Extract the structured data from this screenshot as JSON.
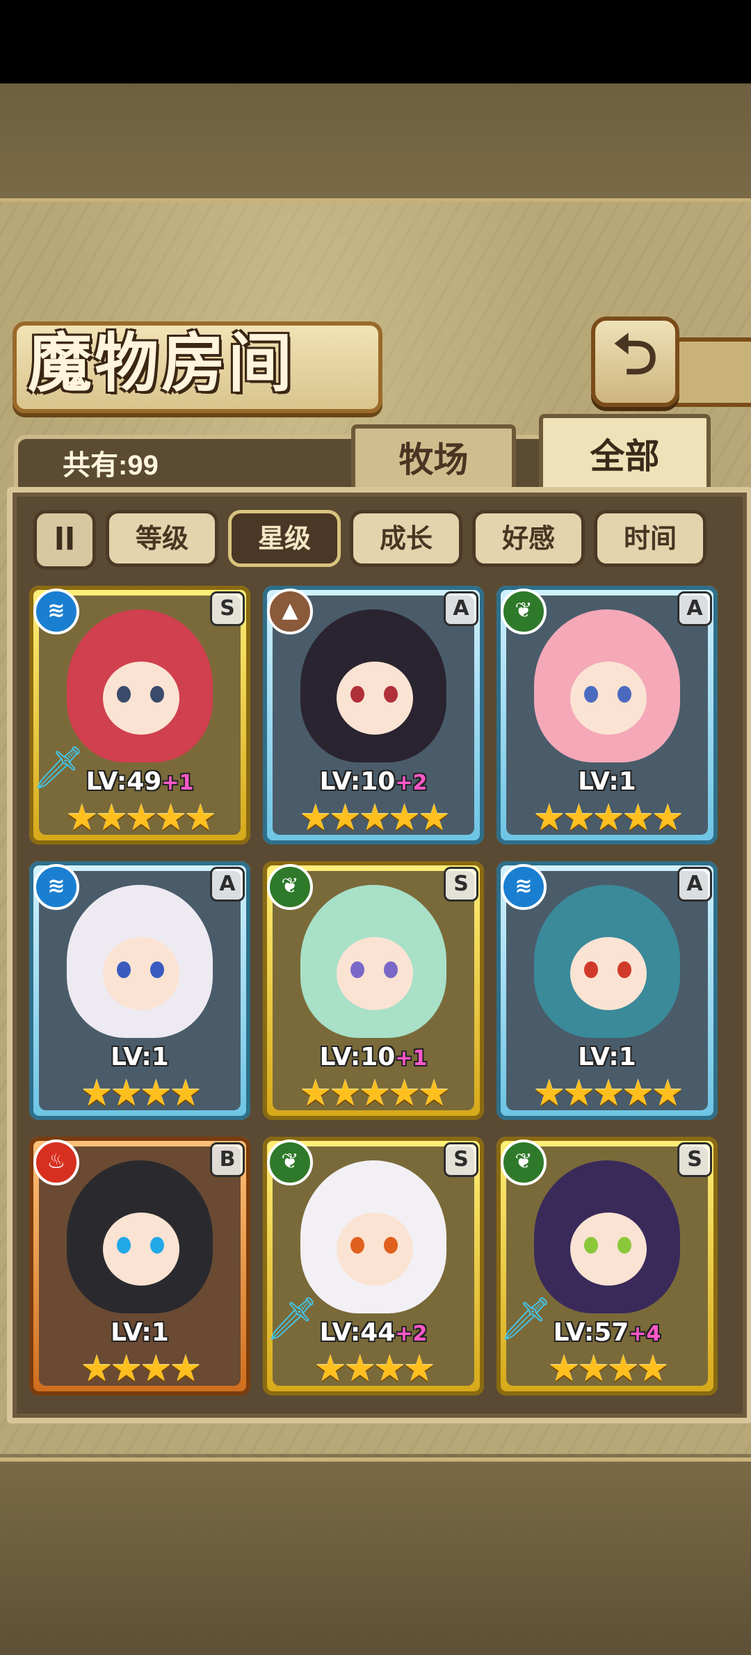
{
  "header": {
    "title": "魔物房间",
    "back_icon": "back-arrow-icon"
  },
  "summary": {
    "count_label": "共有:99"
  },
  "tabs": [
    {
      "label": "牧场",
      "active": false
    },
    {
      "label": "全部",
      "active": true
    }
  ],
  "filters": {
    "toggle_icon": "ll",
    "items": [
      {
        "label": "等级",
        "active": false
      },
      {
        "label": "星级",
        "active": true
      },
      {
        "label": "成长",
        "active": false
      },
      {
        "label": "好感",
        "active": false
      },
      {
        "label": "时间",
        "active": false
      }
    ]
  },
  "cards": [
    {
      "frame": "gold",
      "element": "water",
      "rank": "S",
      "level": "LV:49",
      "plus": "+1",
      "stars": 5,
      "weapon": true,
      "hair": "#d0404e",
      "eyes": "#3a4a6a"
    },
    {
      "frame": "blue",
      "element": "earth",
      "rank": "A",
      "level": "LV:10",
      "plus": "+2",
      "stars": 5,
      "weapon": false,
      "hair": "#2a2430",
      "eyes": "#b0303a"
    },
    {
      "frame": "blue",
      "element": "wood",
      "rank": "A",
      "level": "LV:1",
      "plus": "",
      "stars": 5,
      "weapon": false,
      "hair": "#f4a8b8",
      "eyes": "#4a6ac0"
    },
    {
      "frame": "blue",
      "element": "water",
      "rank": "A",
      "level": "LV:1",
      "plus": "",
      "stars": 4,
      "weapon": false,
      "hair": "#eeeaf2",
      "eyes": "#3a5ac0"
    },
    {
      "frame": "gold",
      "element": "wood",
      "rank": "S",
      "level": "LV:10",
      "plus": "+1",
      "stars": 5,
      "weapon": false,
      "hair": "#a8e0c8",
      "eyes": "#7a68c8"
    },
    {
      "frame": "blue",
      "element": "water",
      "rank": "A",
      "level": "LV:1",
      "plus": "",
      "stars": 5,
      "weapon": false,
      "hair": "#3a8a9a",
      "eyes": "#d03a2a"
    },
    {
      "frame": "orange",
      "element": "fire",
      "rank": "B",
      "level": "LV:1",
      "plus": "",
      "stars": 4,
      "weapon": false,
      "hair": "#2a2a2e",
      "eyes": "#20a8e8"
    },
    {
      "frame": "gold",
      "element": "wood",
      "rank": "S",
      "level": "LV:44",
      "plus": "+2",
      "stars": 4,
      "weapon": true,
      "hair": "#f2f0f4",
      "eyes": "#e0601e"
    },
    {
      "frame": "gold",
      "element": "wood",
      "rank": "S",
      "level": "LV:57",
      "plus": "+4",
      "stars": 4,
      "weapon": true,
      "hair": "#3a2a5a",
      "eyes": "#8ac83a"
    }
  ],
  "element_colors": {
    "water": "#1b7fd1",
    "earth": "#8a5a3a",
    "wood": "#2f7a2a",
    "fire": "#d83020"
  }
}
